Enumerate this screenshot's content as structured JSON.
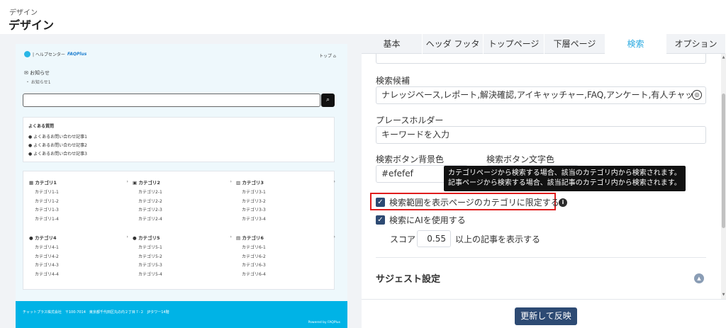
{
  "header": {
    "breadcrumb": "デザイン",
    "title": "デザイン"
  },
  "preview": {
    "logo_text": "| ヘルプセンター",
    "logo_brand": "FAQPlus",
    "top_link": "トップ",
    "notice_title": "お知らせ",
    "notice_item": "・ お知らせ1",
    "search_button_icon": "search-icon",
    "faq_title": "よくある質問",
    "faq_items": [
      "よくあるお問い合わせ記事1",
      "よくあるお問い合わせ記事2",
      "よくあるお問い合わせ記事3"
    ],
    "categories": [
      {
        "name": "カテゴリ1",
        "items": [
          "カテゴリ1-1",
          "カテゴリ1-2",
          "カテゴリ1-3",
          "カテゴリ1-4"
        ]
      },
      {
        "name": "カテゴリ2",
        "items": [
          "カテゴリ2-1",
          "カテゴリ2-2",
          "カテゴリ2-3",
          "カテゴリ2-4"
        ]
      },
      {
        "name": "カテゴリ3",
        "items": [
          "カテゴリ3-1",
          "カテゴリ3-2",
          "カテゴリ3-3",
          "カテゴリ3-4"
        ]
      },
      {
        "name": "カテゴリ4",
        "items": [
          "カテゴリ4-1",
          "カテゴリ4-2",
          "カテゴリ4-3",
          "カテゴリ4-4"
        ]
      },
      {
        "name": "カテゴリ5",
        "items": [
          "カテゴリ5-1",
          "カテゴリ5-2",
          "カテゴリ5-3",
          "カテゴリ5-4"
        ]
      },
      {
        "name": "カテゴリ6",
        "items": [
          "カテゴリ6-1",
          "カテゴリ6-2",
          "カテゴリ6-3",
          "カテゴリ6-4"
        ]
      }
    ],
    "footer_text": "チャットプラス株式会社　〒100-7014　東京都千代田区丸の内２丁目７-２　JPタワー14階",
    "footer_powered": "Powered by FAQPlus"
  },
  "tabs": [
    "基本",
    "ヘッダ フッタ",
    "トップページ",
    "下層ページ",
    "検索",
    "オプション"
  ],
  "active_tab": "検索",
  "form": {
    "suggest_label": "検索候補",
    "suggest_value": "ナレッジベース,レポート,解決確認,アイキャッチャー,FAQ,アンケート,有人チャッ",
    "placeholder_label": "プレースホルダー",
    "placeholder_value": "キーワードを入力",
    "button_bg_label": "検索ボタン背景色",
    "button_bg_value": "#efefef",
    "button_text_label": "検索ボタン文字色",
    "tooltip_line1": "カテゴリページから検索する場合、該当のカテゴリ内から検索されます。",
    "tooltip_line2": "記事ページから検索する場合、該当記事のカテゴリ内から検索されます。",
    "limit_scope_label": "検索範囲を表示ページのカテゴリに限定する。",
    "limit_scope_checked": true,
    "use_ai_label": "検索にAIを使用する",
    "use_ai_checked": true,
    "score_label": "スコア",
    "score_value": "0.55",
    "score_suffix": "以上の記事を表示する",
    "suggest_section_title": "サジェスト設定",
    "update_button": "更新して反映"
  },
  "colors": {
    "accent_tab": "#29a9e0",
    "primary_button": "#2d4a73",
    "highlight": "#e01d1d",
    "preview_footer": "#00b3e6"
  }
}
